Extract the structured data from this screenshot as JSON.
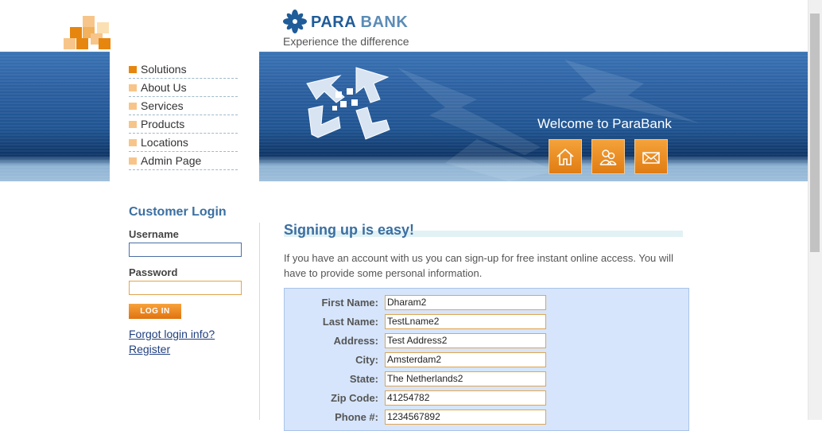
{
  "brand": {
    "name_part1": "PARA",
    "name_part2": "BANK",
    "tagline": "Experience the difference"
  },
  "banner": {
    "welcome": "Welcome to ParaBank",
    "buttons": [
      "home-icon",
      "about-icon",
      "contact-icon"
    ]
  },
  "menu": [
    "Solutions",
    "About Us",
    "Services",
    "Products",
    "Locations",
    "Admin Page"
  ],
  "login": {
    "title": "Customer Login",
    "username_label": "Username",
    "password_label": "Password",
    "username_value": "",
    "password_value": "",
    "button": "LOG IN",
    "forgot": "Forgot login info?",
    "register": "Register"
  },
  "main": {
    "title": "Signing up is easy!",
    "intro": "If you have an account with us you can sign-up for free instant online access. You will have to provide some personal information.",
    "fields": [
      {
        "label": "First Name:",
        "value": "Dharam2"
      },
      {
        "label": "Last Name:",
        "value": "TestLname2"
      },
      {
        "label": "Address:",
        "value": "Test Address2"
      },
      {
        "label": "City:",
        "value": "Amsterdam2"
      },
      {
        "label": "State:",
        "value": "The Netherlands2"
      },
      {
        "label": "Zip Code:",
        "value": "41254782"
      },
      {
        "label": "Phone #:",
        "value": "1234567892"
      }
    ]
  },
  "colors": {
    "accent_orange": "#e07c12",
    "brand_blue": "#1f5c99",
    "banner_blue": "#1f5390"
  }
}
